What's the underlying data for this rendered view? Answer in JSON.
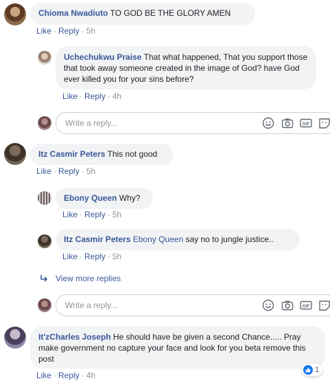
{
  "reply_placeholder": "Write a reply...",
  "like": "Like",
  "reply": "Reply",
  "sep": "·",
  "comments": [
    {
      "author": "Chioma Nwadiuto",
      "text": "TO GOD BE THE GLORY AMEN",
      "time": "5h"
    },
    {
      "author": "Uchechukwu Praise",
      "text": "That what happened, That you support those that took away someone created in the image of God? have God ever killed you for your sins before?",
      "time": "4h"
    },
    {
      "author": "Itz Casmir Peters",
      "text": "This not good",
      "time": "5h"
    },
    {
      "author": "Ebony Queen",
      "text": "Why?",
      "time": "5h"
    },
    {
      "author": "Itz Casmir Peters",
      "mention": "Ebony Queen",
      "text": "say no to jungle justice..",
      "time": "5h"
    },
    {
      "author": "It'zCharles Joseph",
      "text": "He should have be given a second Chance..... Pray make government no capture your face and look for you beta remove this post",
      "time": "4h",
      "reaction_count": "1"
    }
  ],
  "view_more": "View more replies",
  "colors": {
    "link": "#385898",
    "bubble": "#f2f3f5",
    "meta": "#90949c",
    "like_blue": "#1877f2"
  }
}
